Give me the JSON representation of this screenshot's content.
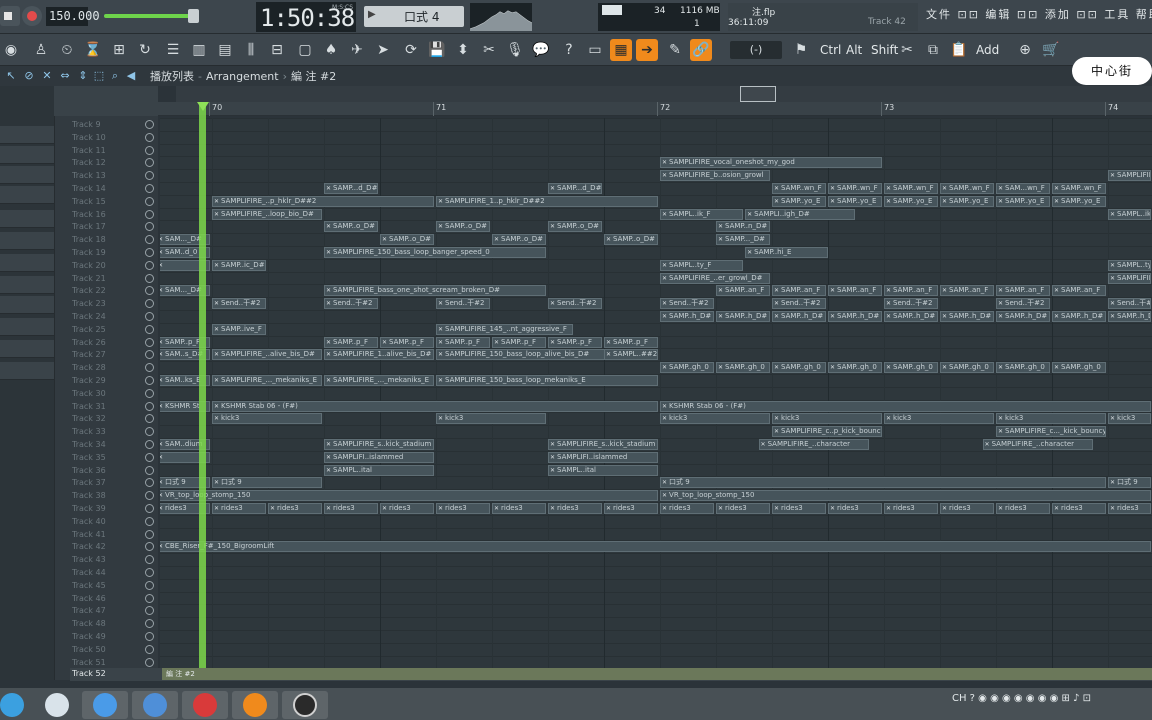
{
  "transport": {
    "tempo": "150.000",
    "time": "1:50:38",
    "time_unit": "M:S:CS",
    "pattern": "口式 4",
    "stop_label": "stop",
    "record_label": "record"
  },
  "stats": {
    "cpu_val": "34",
    "mem_val": "1116 MB",
    "poly_val": "1"
  },
  "file": {
    "name": "注.flp",
    "time": "36:11:09",
    "track": "Track 42"
  },
  "panels": "文件 ⊡⊡ 编辑 ⊡⊡ 添加 ⊡⊡ 工具 帮助",
  "toolbar": {
    "snap": "(-)",
    "ctrl": "Ctrl",
    "alt": "Alt",
    "shift": "Shift",
    "add": "Add"
  },
  "breadcrumb": {
    "part1": "播放列表",
    "part2": "Arrangement",
    "part3": "編 注 #2"
  },
  "logo_text": "中心街",
  "ruler": {
    "bars": [
      "70",
      "71",
      "72",
      "73",
      "74"
    ]
  },
  "tracks": [
    "Track 9",
    "Track 10",
    "Track 11",
    "Track 12",
    "Track 13",
    "Track 14",
    "Track 15",
    "Track 16",
    "Track 17",
    "Track 18",
    "Track 19",
    "Track 20",
    "Track 21",
    "Track 22",
    "Track 23",
    "Track 24",
    "Track 25",
    "Track 26",
    "Track 27",
    "Track 28",
    "Track 29",
    "Track 30",
    "Track 31",
    "Track 32",
    "Track 33",
    "Track 34",
    "Track 35",
    "Track 36",
    "Track 37",
    "Track 38",
    "Track 39",
    "Track 40",
    "Track 41",
    "Track 42",
    "Track 43",
    "Track 44",
    "Track 45",
    "Track 46",
    "Track 47",
    "Track 48",
    "Track 49",
    "Track 50",
    "Track 51"
  ],
  "bottom_track": {
    "label": "Track 52",
    "clip": "編 注 #2"
  },
  "clips": [
    {
      "r": 3,
      "b": 72.0,
      "w": 1.0,
      "t": "SAMPLIFIRE_vocal_oneshot_my_god"
    },
    {
      "r": 4,
      "b": 72.0,
      "w": 0.5,
      "t": "SAMPLIFIRE_b..osion_growl"
    },
    {
      "r": 4,
      "b": 74.0,
      "w": 0.2,
      "t": "SAMPLIFIRE"
    },
    {
      "r": 5,
      "b": 70.5,
      "w": 0.25,
      "t": "SAMP...d_D#"
    },
    {
      "r": 5,
      "b": 71.5,
      "w": 0.25,
      "t": "SAMP...d_D#"
    },
    {
      "r": 5,
      "b": 72.5,
      "w": 0.25,
      "t": "SAMP..wn_F"
    },
    {
      "r": 5,
      "b": 72.75,
      "w": 0.25,
      "t": "SAMP..wn_F"
    },
    {
      "r": 5,
      "b": 73.0,
      "w": 0.25,
      "t": "SAMP..wn_F"
    },
    {
      "r": 5,
      "b": 73.25,
      "w": 0.25,
      "t": "SAMP..wn_F"
    },
    {
      "r": 5,
      "b": 73.5,
      "w": 0.25,
      "t": "SAM...wn_F"
    },
    {
      "r": 5,
      "b": 73.75,
      "w": 0.25,
      "t": "SAMP..wn_F"
    },
    {
      "r": 6,
      "b": 70.0,
      "w": 1.0,
      "t": "SAMPLIFIRE_..p_hklr_D##2"
    },
    {
      "r": 6,
      "b": 71.0,
      "w": 1.0,
      "t": "SAMPLIFIRE_1..p_hklr_D##2"
    },
    {
      "r": 6,
      "b": 72.5,
      "w": 0.25,
      "t": "SAMP..yo_E"
    },
    {
      "r": 6,
      "b": 72.75,
      "w": 0.25,
      "t": "SAMP..yo_E"
    },
    {
      "r": 6,
      "b": 73.0,
      "w": 0.25,
      "t": "SAMP..yo_E"
    },
    {
      "r": 6,
      "b": 73.25,
      "w": 0.25,
      "t": "SAMP..yo_E"
    },
    {
      "r": 6,
      "b": 73.5,
      "w": 0.25,
      "t": "SAMP..yo_E"
    },
    {
      "r": 6,
      "b": 73.75,
      "w": 0.25,
      "t": "SAMP..yo_E"
    },
    {
      "r": 7,
      "b": 70.0,
      "w": 0.5,
      "t": "SAMPLIFIRE_..loop_bio_D#"
    },
    {
      "r": 7,
      "b": 72.0,
      "w": 0.38,
      "t": "SAMPL..ik_F"
    },
    {
      "r": 7,
      "b": 72.38,
      "w": 0.5,
      "t": "SAMPLI..igh_D#"
    },
    {
      "r": 7,
      "b": 74.0,
      "w": 0.2,
      "t": "SAMPL..ik"
    },
    {
      "r": 8,
      "b": 70.5,
      "w": 0.25,
      "t": "SAMP..o_D#"
    },
    {
      "r": 8,
      "b": 71.0,
      "w": 0.25,
      "t": "SAMP..o_D#"
    },
    {
      "r": 8,
      "b": 71.5,
      "w": 0.25,
      "t": "SAMP..o_D#"
    },
    {
      "r": 8,
      "b": 72.25,
      "w": 0.25,
      "t": "SAMP..n_D#"
    },
    {
      "r": 9,
      "b": 69.75,
      "w": 0.25,
      "t": "SAM..._D#"
    },
    {
      "r": 9,
      "b": 70.75,
      "w": 0.25,
      "t": "SAMP..o_D#"
    },
    {
      "r": 9,
      "b": 71.25,
      "w": 0.25,
      "t": "SAMP..o_D#"
    },
    {
      "r": 9,
      "b": 71.75,
      "w": 0.25,
      "t": "SAMP..o_D#"
    },
    {
      "r": 9,
      "b": 72.25,
      "w": 0.25,
      "t": "SAMP..._D#"
    },
    {
      "r": 10,
      "b": 69.75,
      "w": 0.25,
      "t": "SAM..d_0"
    },
    {
      "r": 10,
      "b": 70.5,
      "w": 1.0,
      "t": "SAMPLIFIRE_150_bass_loop_banger_speed_0"
    },
    {
      "r": 10,
      "b": 72.38,
      "w": 0.38,
      "t": "SAMP..hi_E"
    },
    {
      "r": 11,
      "b": 69.75,
      "w": 0.25,
      "t": ""
    },
    {
      "r": 11,
      "b": 70.0,
      "w": 0.25,
      "t": "SAMP..ic_D#"
    },
    {
      "r": 11,
      "b": 72.0,
      "w": 0.38,
      "t": "SAMPL..ty_F"
    },
    {
      "r": 11,
      "b": 74.0,
      "w": 0.2,
      "t": "SAMPL..ty"
    },
    {
      "r": 12,
      "b": 72.0,
      "w": 0.5,
      "t": "SAMPLIFIRE_..er_growl_D#"
    },
    {
      "r": 12,
      "b": 74.0,
      "w": 0.2,
      "t": "SAMPLIFIR"
    },
    {
      "r": 13,
      "b": 69.75,
      "w": 0.25,
      "t": "SAM..._D#"
    },
    {
      "r": 13,
      "b": 70.5,
      "w": 1.0,
      "t": "SAMPLIFIRE_bass_one_shot_scream_broken_D#"
    },
    {
      "r": 13,
      "b": 72.25,
      "w": 0.25,
      "t": "SAMP..an_F"
    },
    {
      "r": 13,
      "b": 72.5,
      "w": 0.25,
      "t": "SAMP..an_F"
    },
    {
      "r": 13,
      "b": 72.75,
      "w": 0.25,
      "t": "SAMP..an_F"
    },
    {
      "r": 13,
      "b": 73.0,
      "w": 0.25,
      "t": "SAMP..an_F"
    },
    {
      "r": 13,
      "b": 73.25,
      "w": 0.25,
      "t": "SAMP..an_F"
    },
    {
      "r": 13,
      "b": 73.5,
      "w": 0.25,
      "t": "SAMP..an_F"
    },
    {
      "r": 13,
      "b": 73.75,
      "w": 0.25,
      "t": "SAMP..an_F"
    },
    {
      "r": 14,
      "b": 70.0,
      "w": 0.25,
      "t": "Send..干#2"
    },
    {
      "r": 14,
      "b": 70.5,
      "w": 0.25,
      "t": "Send..干#2"
    },
    {
      "r": 14,
      "b": 71.0,
      "w": 0.25,
      "t": "Send..干#2"
    },
    {
      "r": 14,
      "b": 71.5,
      "w": 0.25,
      "t": "Send..干#2"
    },
    {
      "r": 14,
      "b": 72.0,
      "w": 0.25,
      "t": "Send..干#2"
    },
    {
      "r": 14,
      "b": 72.5,
      "w": 0.25,
      "t": "Send..干#2"
    },
    {
      "r": 14,
      "b": 73.0,
      "w": 0.25,
      "t": "Send..干#2"
    },
    {
      "r": 14,
      "b": 73.5,
      "w": 0.25,
      "t": "Send..干#2"
    },
    {
      "r": 14,
      "b": 74.0,
      "w": 0.2,
      "t": "Send..干#2"
    },
    {
      "r": 15,
      "b": 72.0,
      "w": 0.25,
      "t": "SAMP..h_D#"
    },
    {
      "r": 15,
      "b": 72.25,
      "w": 0.25,
      "t": "SAMP..h_D#"
    },
    {
      "r": 15,
      "b": 72.5,
      "w": 0.25,
      "t": "SAMP..h_D#"
    },
    {
      "r": 15,
      "b": 72.75,
      "w": 0.25,
      "t": "SAMP..h_D#"
    },
    {
      "r": 15,
      "b": 73.0,
      "w": 0.25,
      "t": "SAMP..h_D#"
    },
    {
      "r": 15,
      "b": 73.25,
      "w": 0.25,
      "t": "SAMP..h_D#"
    },
    {
      "r": 15,
      "b": 73.5,
      "w": 0.25,
      "t": "SAMP..h_D#"
    },
    {
      "r": 15,
      "b": 73.75,
      "w": 0.25,
      "t": "SAMP..h_D#"
    },
    {
      "r": 15,
      "b": 74.0,
      "w": 0.2,
      "t": "SAMP..h_D#"
    },
    {
      "r": 16,
      "b": 70.0,
      "w": 0.25,
      "t": "SAMP..ive_F"
    },
    {
      "r": 16,
      "b": 71.0,
      "w": 0.62,
      "t": "SAMPLIFIRE_145_..nt_aggressive_F"
    },
    {
      "r": 17,
      "b": 69.75,
      "w": 0.25,
      "t": "SAMP..p_F"
    },
    {
      "r": 17,
      "b": 70.5,
      "w": 0.25,
      "t": "SAMP..p_F"
    },
    {
      "r": 17,
      "b": 70.75,
      "w": 0.25,
      "t": "SAMP..p_F"
    },
    {
      "r": 17,
      "b": 71.0,
      "w": 0.25,
      "t": "SAMP..p_F"
    },
    {
      "r": 17,
      "b": 71.25,
      "w": 0.25,
      "t": "SAMP..p_F"
    },
    {
      "r": 17,
      "b": 71.5,
      "w": 0.25,
      "t": "SAMP..p_F"
    },
    {
      "r": 17,
      "b": 71.75,
      "w": 0.25,
      "t": "SAMP..p_F"
    },
    {
      "r": 18,
      "b": 69.75,
      "w": 0.25,
      "t": "SAM..s_D#"
    },
    {
      "r": 18,
      "b": 70.0,
      "w": 0.5,
      "t": "SAMPLIFIRE_..alive_bis_D#"
    },
    {
      "r": 18,
      "b": 70.5,
      "w": 0.5,
      "t": "SAMPLIFIRE_1..alive_bis_D#"
    },
    {
      "r": 18,
      "b": 71.0,
      "w": 1.0,
      "t": "SAMPLIFIRE_150_bass_loop_alive_bis_D#"
    },
    {
      "r": 18,
      "b": 71.75,
      "w": 0.25,
      "t": "SAMPL..##2"
    },
    {
      "r": 19,
      "b": 72.0,
      "w": 0.25,
      "t": "SAMP..gh_0"
    },
    {
      "r": 19,
      "b": 72.25,
      "w": 0.25,
      "t": "SAMP..gh_0"
    },
    {
      "r": 19,
      "b": 72.5,
      "w": 0.25,
      "t": "SAMP..gh_0"
    },
    {
      "r": 19,
      "b": 72.75,
      "w": 0.25,
      "t": "SAMP..gh_0"
    },
    {
      "r": 19,
      "b": 73.0,
      "w": 0.25,
      "t": "SAMP..gh_0"
    },
    {
      "r": 19,
      "b": 73.25,
      "w": 0.25,
      "t": "SAMP..gh_0"
    },
    {
      "r": 19,
      "b": 73.5,
      "w": 0.25,
      "t": "SAMP..gh_0"
    },
    {
      "r": 19,
      "b": 73.75,
      "w": 0.25,
      "t": "SAMP..gh_0"
    },
    {
      "r": 20,
      "b": 69.75,
      "w": 0.25,
      "t": "SAM..ks_E"
    },
    {
      "r": 20,
      "b": 70.0,
      "w": 0.5,
      "t": "SAMPLIFIRE_..._mekaniks_E"
    },
    {
      "r": 20,
      "b": 70.5,
      "w": 0.5,
      "t": "SAMPLIFIRE_..._mekaniks_E"
    },
    {
      "r": 20,
      "b": 71.0,
      "w": 1.0,
      "t": "SAMPLIFIRE_150_bass_loop_mekaniks_E"
    },
    {
      "r": 22,
      "b": 69.75,
      "w": 0.25,
      "t": "KSHMR St"
    },
    {
      "r": 22,
      "b": 70.0,
      "w": 2.0,
      "t": "KSHMR Stab 06 - (F#)"
    },
    {
      "r": 22,
      "b": 72.0,
      "w": 2.2,
      "t": "KSHMR Stab 06 - (F#)"
    },
    {
      "r": 23,
      "b": 70.0,
      "w": 0.5,
      "t": "kick3"
    },
    {
      "r": 23,
      "b": 71.0,
      "w": 0.5,
      "t": "kick3"
    },
    {
      "r": 23,
      "b": 72.0,
      "w": 0.5,
      "t": "kick3"
    },
    {
      "r": 23,
      "b": 72.5,
      "w": 0.5,
      "t": "kick3"
    },
    {
      "r": 23,
      "b": 73.0,
      "w": 0.5,
      "t": "kick3"
    },
    {
      "r": 23,
      "b": 73.5,
      "w": 0.5,
      "t": "kick3"
    },
    {
      "r": 23,
      "b": 74.0,
      "w": 0.2,
      "t": "kick3"
    },
    {
      "r": 24,
      "b": 72.5,
      "w": 0.5,
      "t": "SAMPLIFIRE_c..p_kick_bouncy"
    },
    {
      "r": 24,
      "b": 73.5,
      "w": 0.5,
      "t": "SAMPLIFIRE_c..._kick_bouncy"
    },
    {
      "r": 25,
      "b": 69.75,
      "w": 0.25,
      "t": "SAM..dium"
    },
    {
      "r": 25,
      "b": 70.5,
      "w": 0.5,
      "t": "SAMPLIFIRE_s..kick_stadium"
    },
    {
      "r": 25,
      "b": 71.5,
      "w": 0.5,
      "t": "SAMPLIFIRE_s..kick_stadium"
    },
    {
      "r": 25,
      "b": 72.44,
      "w": 0.5,
      "t": "SAMPLIFIRE_..character"
    },
    {
      "r": 25,
      "b": 73.44,
      "w": 0.5,
      "t": "SAMPLIFIRE_..character"
    },
    {
      "r": 26,
      "b": 69.75,
      "w": 0.25,
      "t": ""
    },
    {
      "r": 26,
      "b": 70.5,
      "w": 0.5,
      "t": "SAMPLIFI..islammed"
    },
    {
      "r": 26,
      "b": 71.5,
      "w": 0.5,
      "t": "SAMPLIFI..islammed"
    },
    {
      "r": 27,
      "b": 70.5,
      "w": 0.5,
      "t": "SAMPL..ital"
    },
    {
      "r": 27,
      "b": 71.5,
      "w": 0.5,
      "t": "SAMPL..ital"
    },
    {
      "r": 28,
      "b": 69.75,
      "w": 0.25,
      "t": "口式 9"
    },
    {
      "r": 28,
      "b": 70.0,
      "w": 0.5,
      "t": "口式 9"
    },
    {
      "r": 28,
      "b": 72.0,
      "w": 2.0,
      "t": "口式 9"
    },
    {
      "r": 28,
      "b": 74.0,
      "w": 0.2,
      "t": "口式 9"
    },
    {
      "r": 29,
      "b": 69.75,
      "w": 2.25,
      "t": "VR_top_loop_stomp_150"
    },
    {
      "r": 29,
      "b": 72.0,
      "w": 2.2,
      "t": "VR_top_loop_stomp_150"
    },
    {
      "r": 30,
      "b": 69.75,
      "w": 0.25,
      "t": "rides3"
    },
    {
      "r": 30,
      "b": 70.0,
      "w": 0.25,
      "t": "rides3"
    },
    {
      "r": 30,
      "b": 70.25,
      "w": 0.25,
      "t": "rides3"
    },
    {
      "r": 30,
      "b": 70.5,
      "w": 0.25,
      "t": "rides3"
    },
    {
      "r": 30,
      "b": 70.75,
      "w": 0.25,
      "t": "rides3"
    },
    {
      "r": 30,
      "b": 71.0,
      "w": 0.25,
      "t": "rides3"
    },
    {
      "r": 30,
      "b": 71.25,
      "w": 0.25,
      "t": "rides3"
    },
    {
      "r": 30,
      "b": 71.5,
      "w": 0.25,
      "t": "rides3"
    },
    {
      "r": 30,
      "b": 71.75,
      "w": 0.25,
      "t": "rides3"
    },
    {
      "r": 30,
      "b": 72.0,
      "w": 0.25,
      "t": "rides3"
    },
    {
      "r": 30,
      "b": 72.25,
      "w": 0.25,
      "t": "rides3"
    },
    {
      "r": 30,
      "b": 72.5,
      "w": 0.25,
      "t": "rides3"
    },
    {
      "r": 30,
      "b": 72.75,
      "w": 0.25,
      "t": "rides3"
    },
    {
      "r": 30,
      "b": 73.0,
      "w": 0.25,
      "t": "rides3"
    },
    {
      "r": 30,
      "b": 73.25,
      "w": 0.25,
      "t": "rides3"
    },
    {
      "r": 30,
      "b": 73.5,
      "w": 0.25,
      "t": "rides3"
    },
    {
      "r": 30,
      "b": 73.75,
      "w": 0.25,
      "t": "rides3"
    },
    {
      "r": 30,
      "b": 74.0,
      "w": 0.2,
      "t": "rides3"
    },
    {
      "r": 33,
      "b": 69.75,
      "w": 4.45,
      "t": "CBE_Riser_F#_150_BigroomLift"
    }
  ],
  "taskbar": {
    "tray": "CH ? ◉ ◉ ◉ ◉ ◉ ◉ ◉ ⊞ ♪ ⊡"
  }
}
